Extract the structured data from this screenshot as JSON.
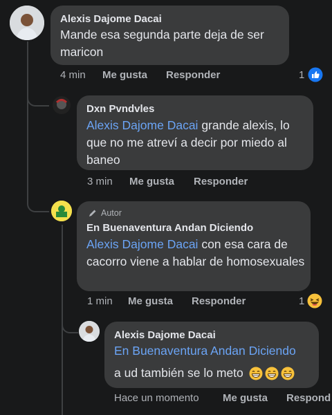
{
  "comments": [
    {
      "author": "Alexis Dajome Dacai",
      "text": "Mande esa segunda parte deja de ser maricon",
      "time": "4 min",
      "like_label": "Me gusta",
      "reply_label": "Responder",
      "reactions_count": "1",
      "reaction_icon": "like-icon"
    },
    {
      "author": "Dxn Pvndvles",
      "mention": "Alexis Dajome Dacai",
      "text": " grande alexis, lo que no me atreví a decir por miedo al baneo",
      "time": "3 min",
      "like_label": "Me gusta",
      "reply_label": "Responder"
    },
    {
      "badge": "Autor",
      "author": "En Buenaventura Andan Diciendo",
      "mention": "Alexis Dajome Dacai",
      "text": " con esa cara de cacorro viene a hablar de homosexuales",
      "time": "1 min",
      "like_label": "Me gusta",
      "reply_label": "Responder",
      "reactions_count": "1",
      "reaction_icon": "haha-icon"
    },
    {
      "author": "Alexis Dajome Dacai",
      "mention": "En Buenaventura Andan Diciendo",
      "text": "a ud también se lo meto",
      "emojis": [
        "grin-icon",
        "grin-icon",
        "grin-icon"
      ],
      "time": "Hace un momento",
      "like_label": "Me gusta",
      "reply_label": "Respond"
    }
  ],
  "colors": {
    "background": "#18191a",
    "bubble": "#3a3b3c",
    "mention": "#6ba4f5",
    "like_blue": "#1877f2"
  }
}
